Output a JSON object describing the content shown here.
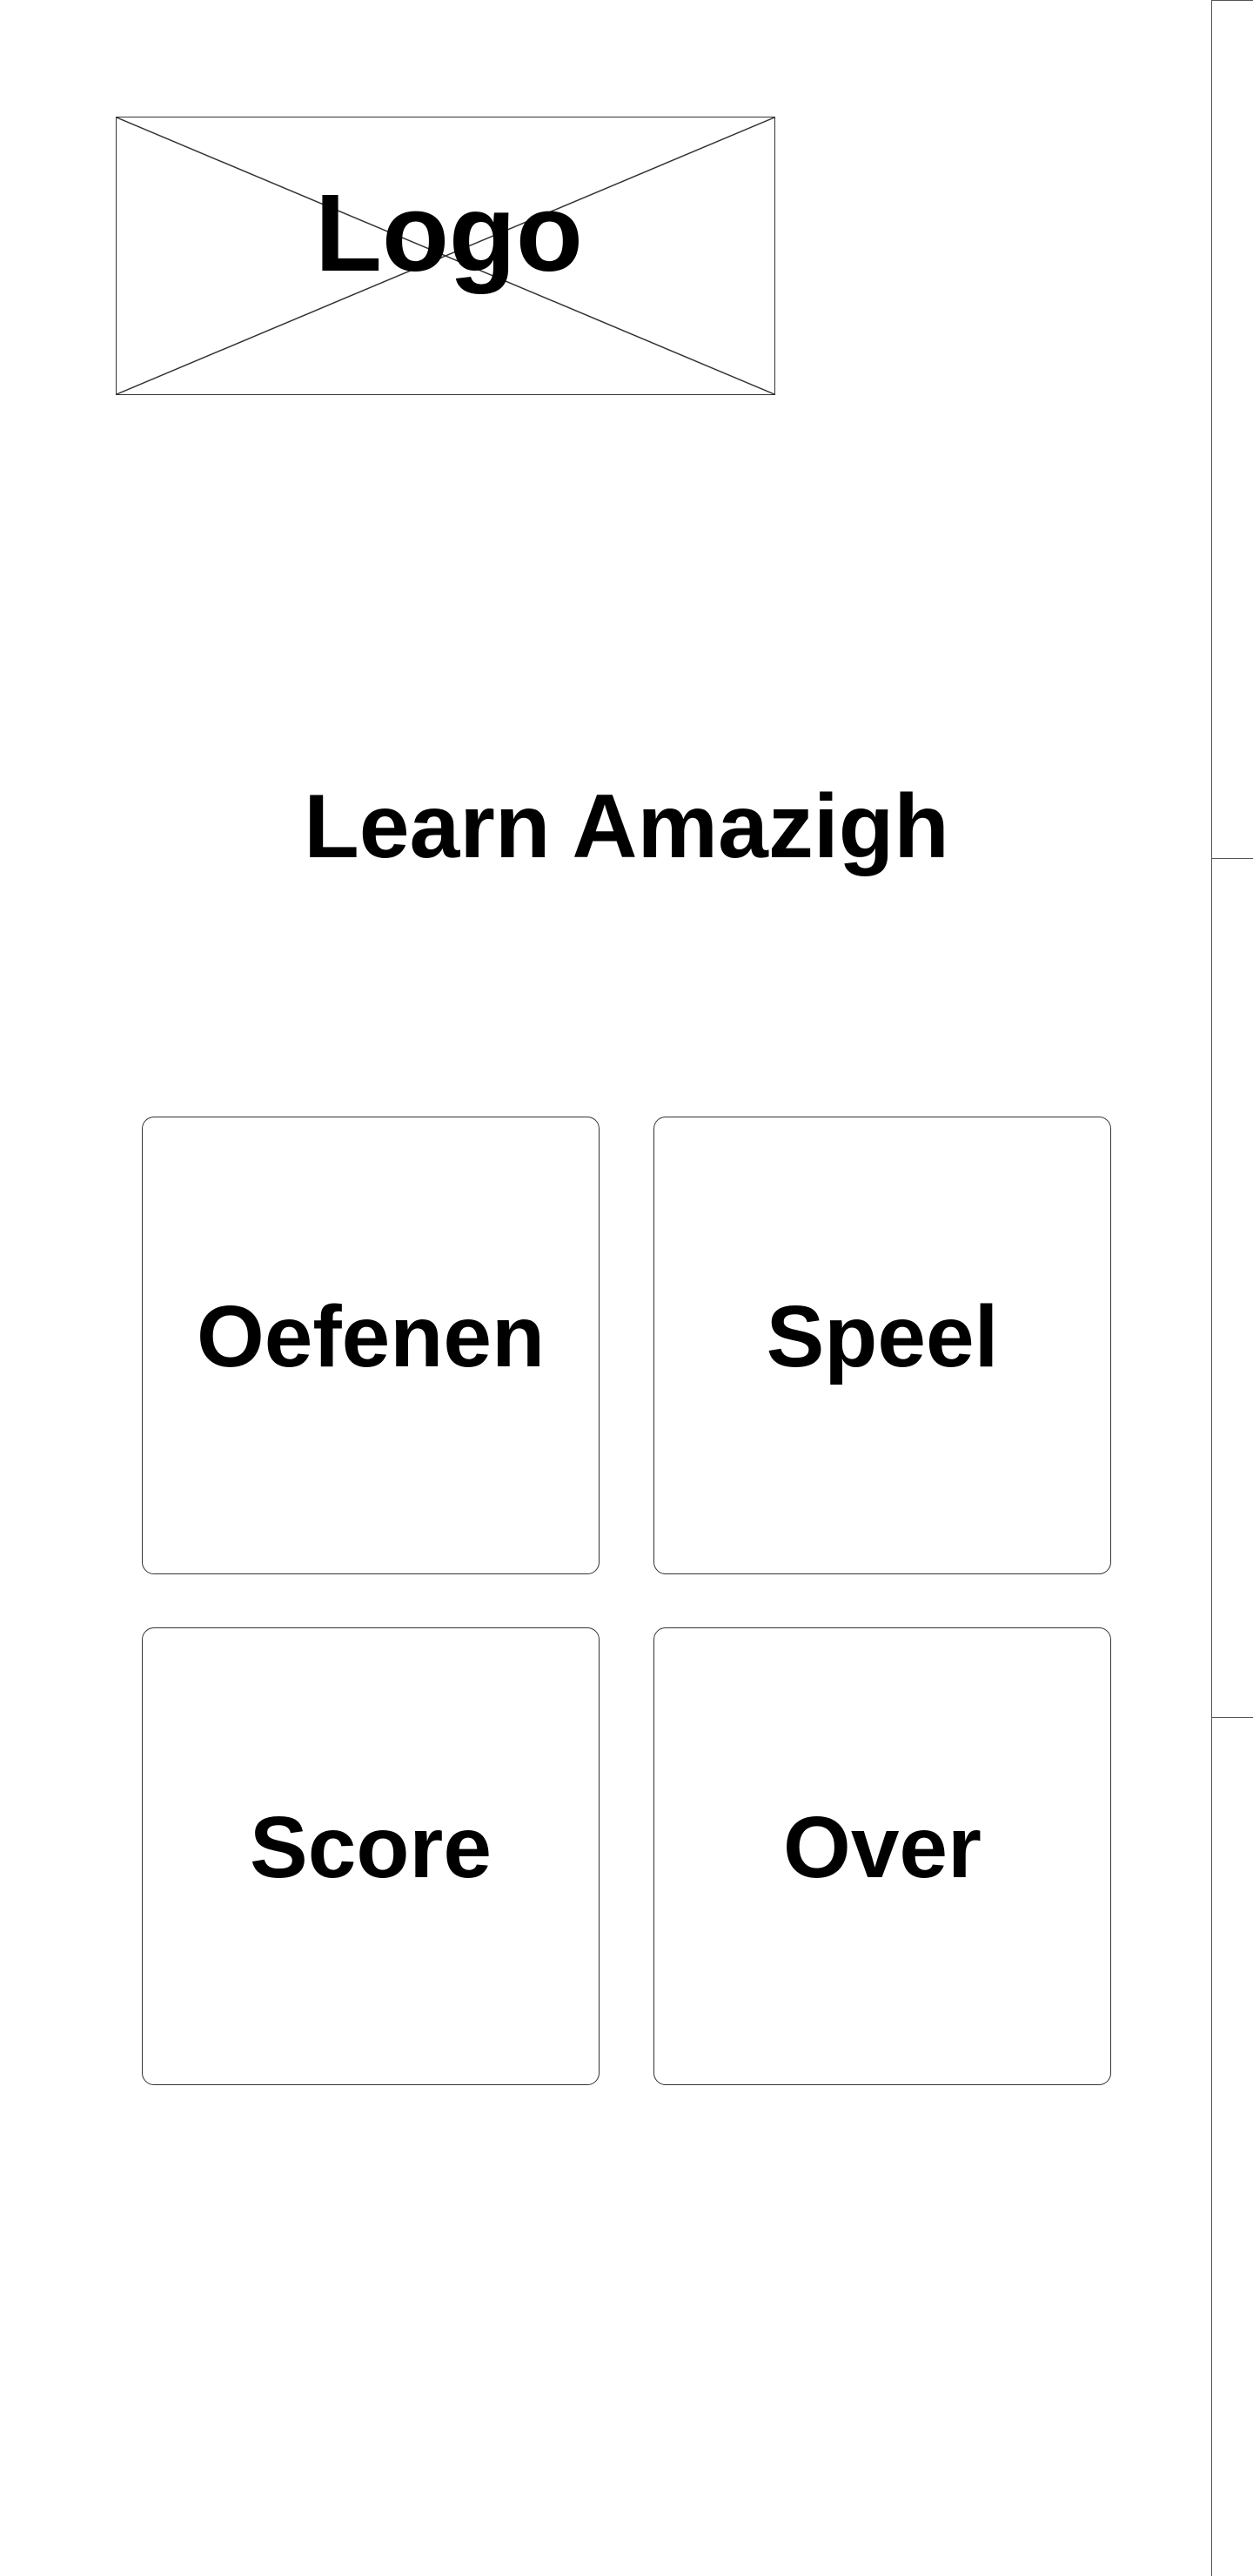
{
  "logo": {
    "label": "Logo"
  },
  "header": {
    "title": "Learn Amazigh"
  },
  "menu": {
    "items": [
      {
        "label": "Oefenen"
      },
      {
        "label": "Speel"
      },
      {
        "label": "Score"
      },
      {
        "label": "Over"
      }
    ]
  }
}
